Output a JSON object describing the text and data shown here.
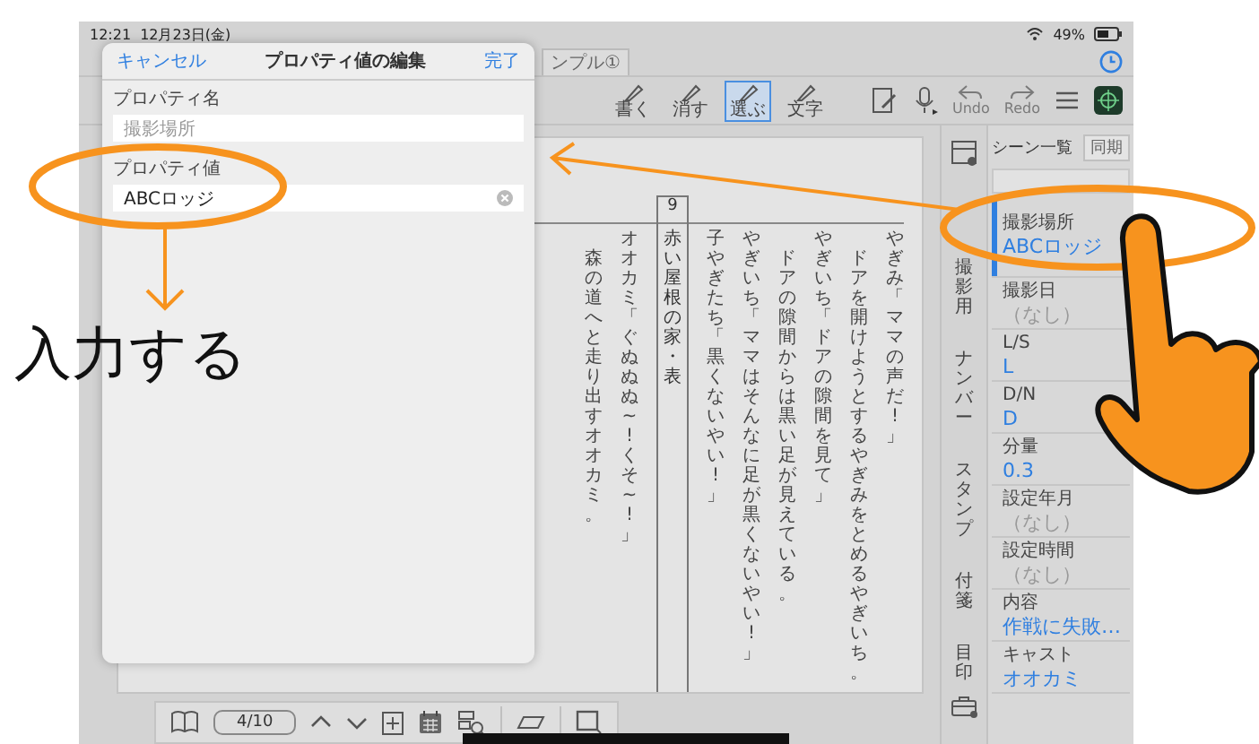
{
  "status_bar": {
    "time": "12:21",
    "date": "12月23日(金)",
    "battery": "49%"
  },
  "tab_bar": {
    "tabs": [
      {
        "label": "ンプル①"
      }
    ]
  },
  "toolbar": {
    "tools": [
      {
        "label": "書く",
        "selected": false
      },
      {
        "label": "消す",
        "selected": false
      },
      {
        "label": "選ぶ",
        "selected": true
      },
      {
        "label": "文字",
        "selected": false
      }
    ],
    "undo": {
      "label": "Undo",
      "disabled": true
    },
    "redo": {
      "label": "Redo",
      "disabled": true
    }
  },
  "document": {
    "columns": [
      {
        "kind": "action",
        "text": "森の道へと走り出すオオカミ。"
      },
      {
        "kind": "dialogue",
        "text": "オオカミ「ぐぬぬぬ~!くそ~!」"
      },
      {
        "kind": "scene",
        "number": "9",
        "text": "赤い屋根の家・表"
      },
      {
        "kind": "dialogue",
        "text": "子やぎたち「黒くないやい!」"
      },
      {
        "kind": "dialogue",
        "text": "やぎいち「ママはそんなに足が黒くないやい!」"
      },
      {
        "kind": "action",
        "text": "ドアの隙間からは黒い足が見えている。"
      },
      {
        "kind": "dialogue",
        "text": "やぎいち「ドアの隙間を見て」"
      },
      {
        "kind": "action",
        "text": "ドアを開けようとするやぎみをとめるやぎいち。"
      },
      {
        "kind": "dialogue",
        "text": "やぎみ「ママの声だ!」"
      }
    ]
  },
  "modal": {
    "cancel": "キャンセル",
    "title": "プロパティ値の編集",
    "done": "完了",
    "name_label": "プロパティ名",
    "name_value": "撮影場所",
    "value_label": "プロパティ値",
    "value": "ABCロッジ"
  },
  "side_tabs": [
    "撮影用",
    "ナンバー",
    "スタンプ",
    "付箋",
    "目印"
  ],
  "scene_panel": {
    "title": "シーン一覧",
    "sync": "同期",
    "properties": [
      {
        "name": "撮影場所",
        "value": "ABCロッジ",
        "selected": true,
        "empty": false
      },
      {
        "name": "撮影日",
        "value": "（なし）",
        "selected": false,
        "empty": true
      },
      {
        "name": "L/S",
        "value": "L",
        "selected": false,
        "empty": false
      },
      {
        "name": "D/N",
        "value": "D",
        "selected": false,
        "empty": false
      },
      {
        "name": "分量",
        "value": "0.3",
        "selected": false,
        "empty": false
      },
      {
        "name": "設定年月",
        "value": "（なし）",
        "selected": false,
        "empty": true
      },
      {
        "name": "設定時間",
        "value": "（なし）",
        "selected": false,
        "empty": true
      },
      {
        "name": "内容",
        "value": "作戦に失敗…",
        "selected": false,
        "empty": false
      },
      {
        "name": "キャスト",
        "value": "オオカミ",
        "selected": false,
        "empty": false
      }
    ]
  },
  "page_nav": {
    "page": "4/10"
  },
  "annotation": {
    "label": "入力する"
  }
}
